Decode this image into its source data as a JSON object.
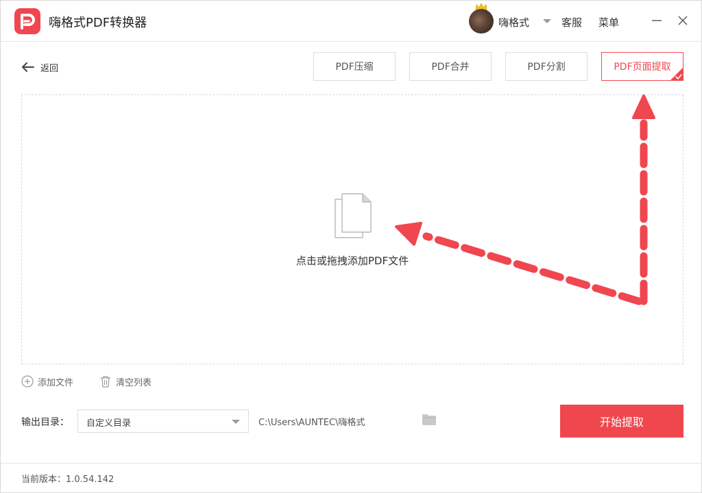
{
  "app": {
    "title": "嗨格式PDF转换器"
  },
  "user": {
    "name": "嗨格式"
  },
  "titlebar": {
    "service_label": "客服",
    "menu_label": "菜单"
  },
  "nav": {
    "back_label": "返回"
  },
  "tools": [
    {
      "label": "PDF压缩",
      "active": false
    },
    {
      "label": "PDF合并",
      "active": false
    },
    {
      "label": "PDF分割",
      "active": false
    },
    {
      "label": "PDF页面提取",
      "active": true
    }
  ],
  "dropzone": {
    "hint": "点击或拖拽添加PDF文件"
  },
  "actions": {
    "add_file": "添加文件",
    "clear_list": "清空列表"
  },
  "output": {
    "label": "输出目录：",
    "select_value": "自定义目录",
    "path": "C:\\Users\\AUNTEC\\嗨格式"
  },
  "start_button": "开始提取",
  "footer": {
    "version": "当前版本：1.0.54.142"
  },
  "colors": {
    "accent": "#f0474f",
    "annotation": "#f04650"
  },
  "icons": {
    "logo": "pdf-logo-icon",
    "back": "arrow-left-icon",
    "add": "plus-circle-icon",
    "trash": "trash-icon",
    "folder": "folder-icon",
    "file": "document-stack-icon",
    "check": "check-corner-icon"
  }
}
